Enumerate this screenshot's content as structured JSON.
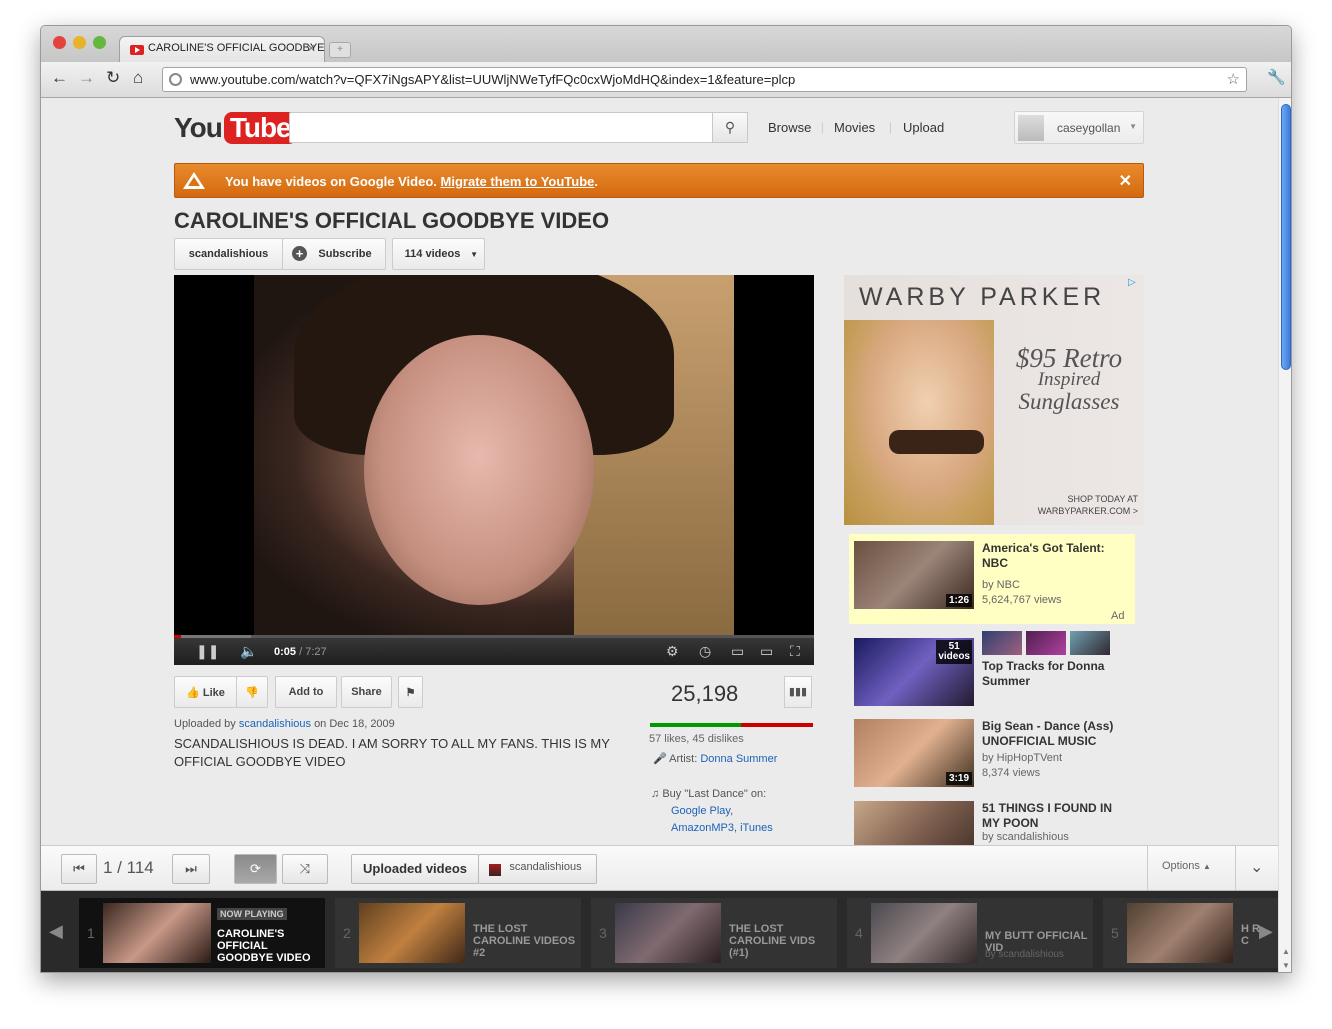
{
  "browser": {
    "tab_title": "CAROLINE'S OFFICIAL GOODBYE VIDEO",
    "url": "www.youtube.com/watch?v=QFX7iNgsAPY&list=UUWljNWeTyfFQc0cxWjoMdHQ&index=1&feature=plcp",
    "new_tab": "+"
  },
  "header": {
    "logo_you": "You",
    "logo_tube": "Tube",
    "search_placeholder": "",
    "nav": [
      "Browse",
      "Movies",
      "Upload"
    ],
    "username": "caseygollan"
  },
  "banner": {
    "text": "You have videos on Google Video.",
    "link": "Migrate them to YouTube",
    "suffix": "."
  },
  "video": {
    "title": "CAROLINE'S OFFICIAL GOODBYE VIDEO",
    "channel": "scandalishious",
    "subscribe": "Subscribe",
    "video_count": "114 videos",
    "current_time": "0:05",
    "duration": "7:27",
    "progress": 0.011,
    "buffered": 0.12,
    "like": "Like",
    "add_to": "Add to",
    "share": "Share",
    "views": "25,198",
    "likes_text": "57 likes, 45 dislikes",
    "like_ratio": 0.56,
    "uploaded_by_prefix": "Uploaded by",
    "uploader": "scandalishious",
    "upload_date": "on Dec 18, 2009",
    "description": "SCANDALISHIOUS IS DEAD. I AM SORRY TO ALL MY FANS. THIS IS MY OFFICIAL GOODBYE VIDEO",
    "artist_label": "Artist:",
    "artist": "Donna Summer",
    "buy_text": "Buy \"Last Dance\" on:",
    "buy_links": [
      "Google Play",
      "AmazonMP3",
      "iTunes"
    ]
  },
  "ad": {
    "brand": "WARBY PARKER",
    "price": "$95 Retro",
    "line2": "Inspired",
    "line3": "Sunglasses",
    "cta1": "SHOP TODAY AT",
    "cta2": "WARBYPARKER.COM >"
  },
  "related": [
    {
      "title": "America's Got Talent: NBC",
      "by": "by NBC",
      "views": "5,624,767 views",
      "duration": "1:26",
      "ad_label": "Ad"
    },
    {
      "title": "Top Tracks for Donna Summer",
      "count": "51",
      "count_label": "videos"
    },
    {
      "title": "Big Sean - Dance (Ass) UNOFFICIAL MUSIC",
      "by": "by HipHopTVent",
      "views": "8,374 views",
      "duration": "3:19"
    },
    {
      "title": "51 THINGS I FOUND IN MY POON",
      "by": "by scandalishious"
    }
  ],
  "playlist": {
    "position": "1 / 114",
    "list_name": "Uploaded videos",
    "owner": "scandalishious",
    "options": "Options",
    "now_playing": "NOW PLAYING",
    "items": [
      {
        "n": "1",
        "title": "CAROLINE'S OFFICIAL GOODBYE VIDEO"
      },
      {
        "n": "2",
        "title": "THE LOST CAROLINE VIDEOS #2"
      },
      {
        "n": "3",
        "title": "THE LOST CAROLINE VIDS (#1)"
      },
      {
        "n": "4",
        "title": "MY BUTT OFFICIAL VID",
        "by": "by scandalishious"
      },
      {
        "n": "5",
        "title": "H R C"
      }
    ]
  }
}
